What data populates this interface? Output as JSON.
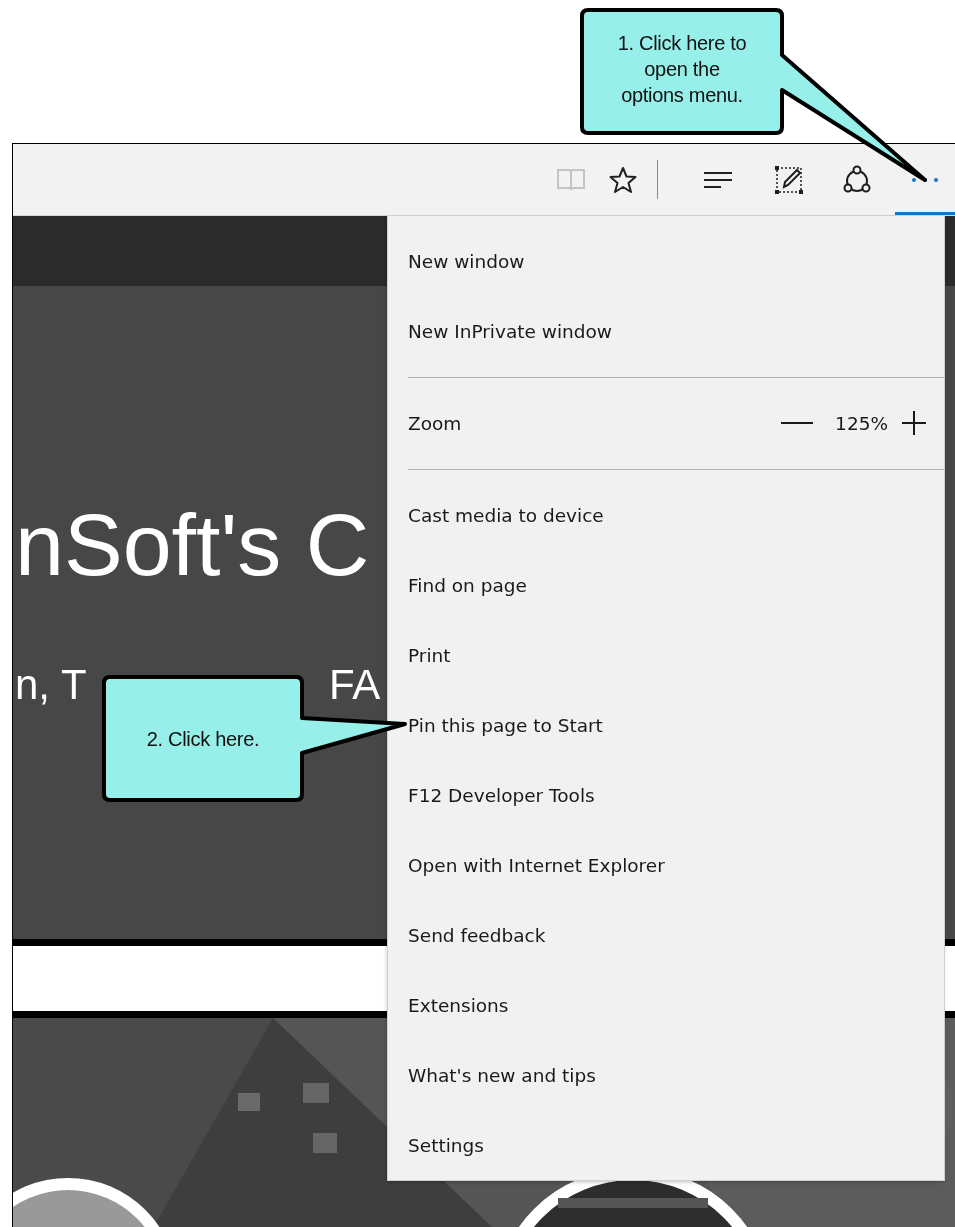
{
  "callouts": [
    {
      "lines": [
        "1. Click here to",
        "open the",
        "options menu."
      ]
    },
    {
      "lines": [
        "2. Click here."
      ]
    }
  ],
  "toolbar": {
    "groups": [
      [
        {
          "kind": "reading-view",
          "disabled": true,
          "selected": false
        },
        {
          "kind": "favorite",
          "disabled": false,
          "selected": false
        }
      ],
      [
        {
          "kind": "hub",
          "disabled": false,
          "selected": false
        },
        {
          "kind": "note",
          "disabled": false,
          "selected": false
        },
        {
          "kind": "share",
          "disabled": false,
          "selected": false
        },
        {
          "kind": "more",
          "disabled": false,
          "selected": true
        }
      ]
    ]
  },
  "web_page": {
    "hero_title": "nSoft's C",
    "hero_subtitle": "n, T",
    "hero_subtitle_tail": "FA"
  },
  "menu": [
    {
      "kind": "item",
      "label": "New window"
    },
    {
      "kind": "item",
      "label": "New InPrivate window"
    },
    {
      "kind": "separator"
    },
    {
      "kind": "zoom",
      "label": "Zoom",
      "value": "125%"
    },
    {
      "kind": "separator"
    },
    {
      "kind": "item",
      "label": "Cast media to device"
    },
    {
      "kind": "item",
      "label": "Find on page"
    },
    {
      "kind": "item",
      "label": "Print"
    },
    {
      "kind": "item",
      "label": "Pin this page to Start"
    },
    {
      "kind": "item",
      "label": "F12 Developer Tools"
    },
    {
      "kind": "item",
      "label": "Open with Internet Explorer"
    },
    {
      "kind": "item",
      "label": "Send feedback"
    },
    {
      "kind": "item",
      "label": "Extensions"
    },
    {
      "kind": "item",
      "label": "What's new and tips"
    },
    {
      "kind": "item",
      "label": "Settings"
    }
  ]
}
